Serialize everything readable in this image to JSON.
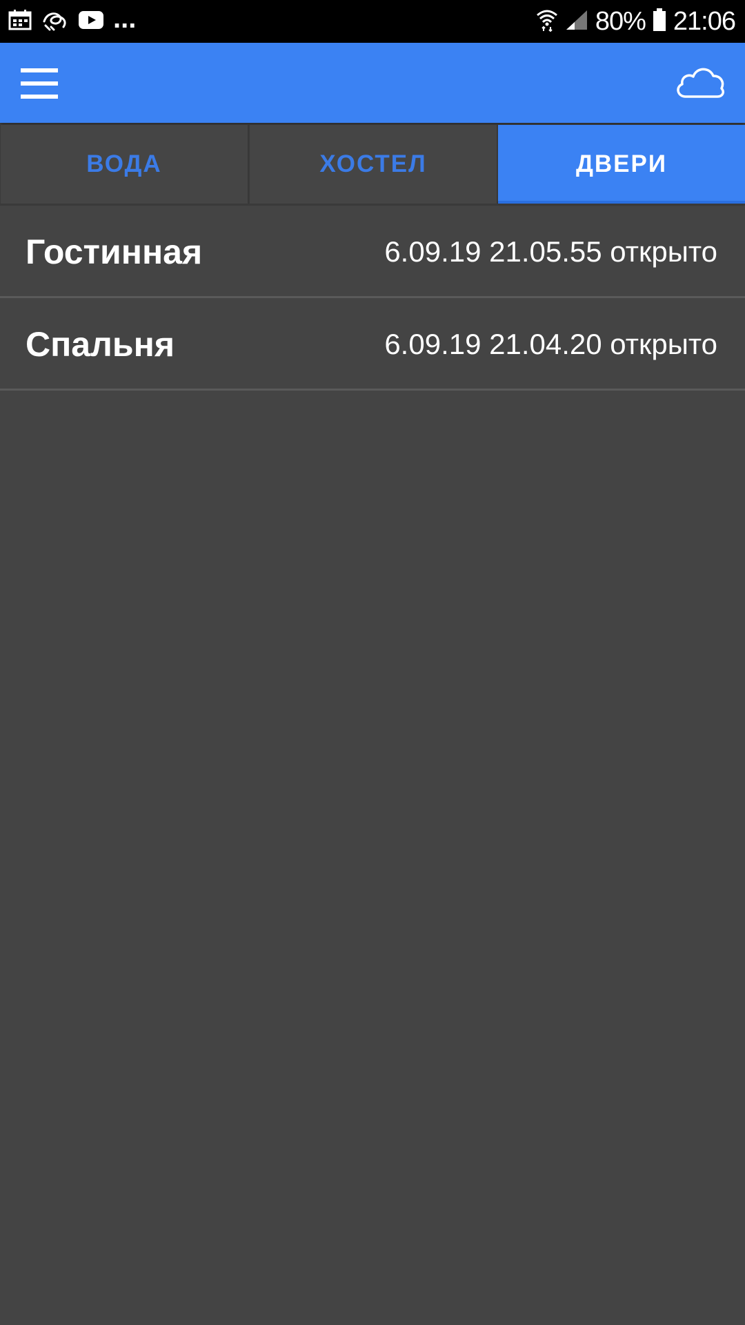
{
  "status_bar": {
    "battery_percent": "80%",
    "time": "21:06",
    "overflow": "...",
    "notification_icons": [
      "calendar-icon",
      "scribble-icon",
      "youtube-icon"
    ],
    "system_icons": [
      "wifi-icon",
      "signal-icon",
      "battery-icon"
    ]
  },
  "app_bar": {
    "menu_icon": "hamburger-menu-icon",
    "action_icon": "cloud-icon",
    "background_color": "#3b82f3"
  },
  "tabs": [
    {
      "label": "ВОДА",
      "active": false
    },
    {
      "label": "ХОСТЕЛ",
      "active": false
    },
    {
      "label": "ДВЕРИ",
      "active": true
    }
  ],
  "list": {
    "items": [
      {
        "name": "Гостинная",
        "status": "6.09.19 21.05.55 открыто"
      },
      {
        "name": "Спальня",
        "status": "6.09.19 21.04.20 открыто"
      }
    ]
  },
  "colors": {
    "accent": "#3b82f3",
    "inactive_tab_text": "#3b7be6",
    "background": "#444444"
  }
}
